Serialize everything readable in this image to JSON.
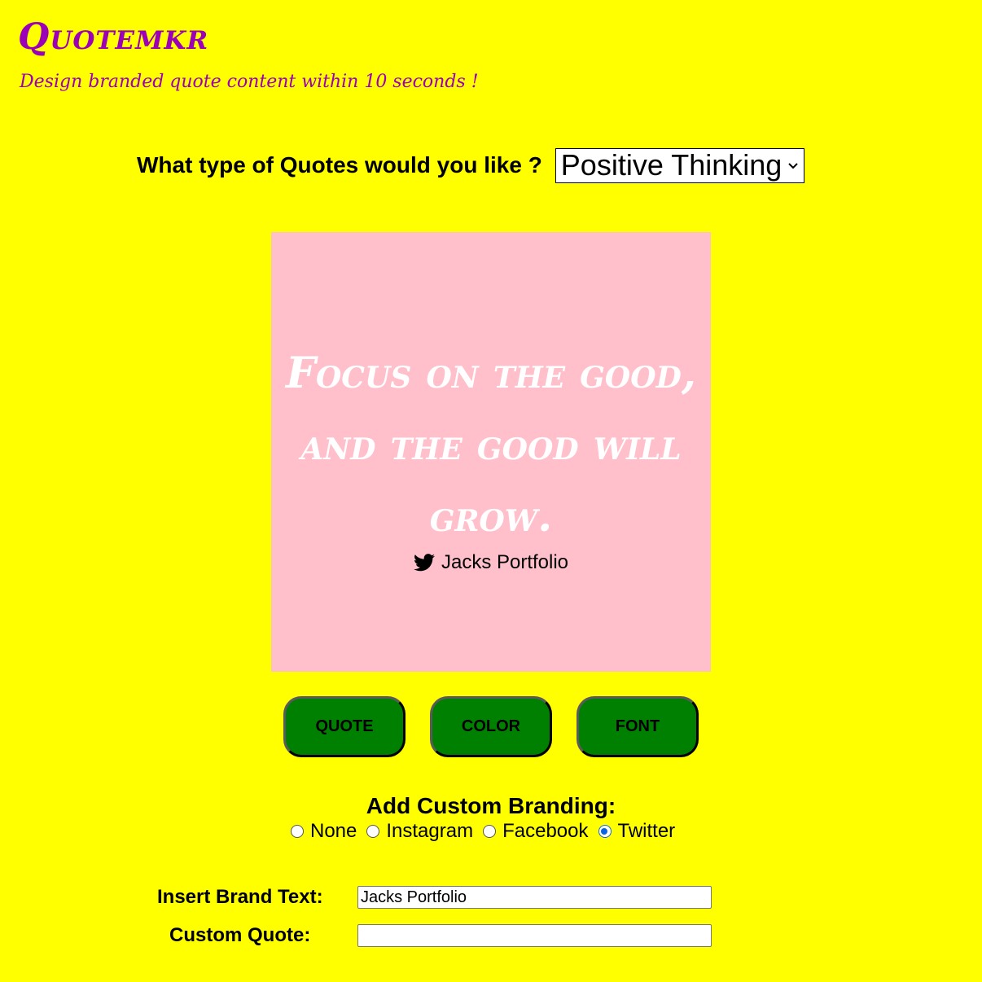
{
  "header": {
    "title": "Quotemkr",
    "tagline": "Design branded quote content within 10 seconds !"
  },
  "quote_type": {
    "label": "What type of Quotes would you like ?",
    "selected": "Positive Thinking"
  },
  "card": {
    "background": "#ffc0cb",
    "quote": "Focus on the good, and the good will grow.",
    "brand_icon": "twitter-icon",
    "brand_text": "Jacks Portfolio"
  },
  "buttons": {
    "quote": "QUOTE",
    "color": "COLOR",
    "font": "FONT"
  },
  "branding": {
    "title": "Add Custom Branding:",
    "options": [
      {
        "label": "None",
        "checked": false
      },
      {
        "label": "Instagram",
        "checked": false
      },
      {
        "label": "Facebook",
        "checked": false
      },
      {
        "label": "Twitter",
        "checked": true
      }
    ]
  },
  "form": {
    "brand_text_label": "Insert Brand Text:",
    "brand_text_value": "Jacks Portfolio",
    "custom_quote_label": "Custom Quote:",
    "custom_quote_value": ""
  },
  "colors": {
    "page_background": "#ffff00",
    "accent": "#9b00b8",
    "button": "#008000"
  }
}
